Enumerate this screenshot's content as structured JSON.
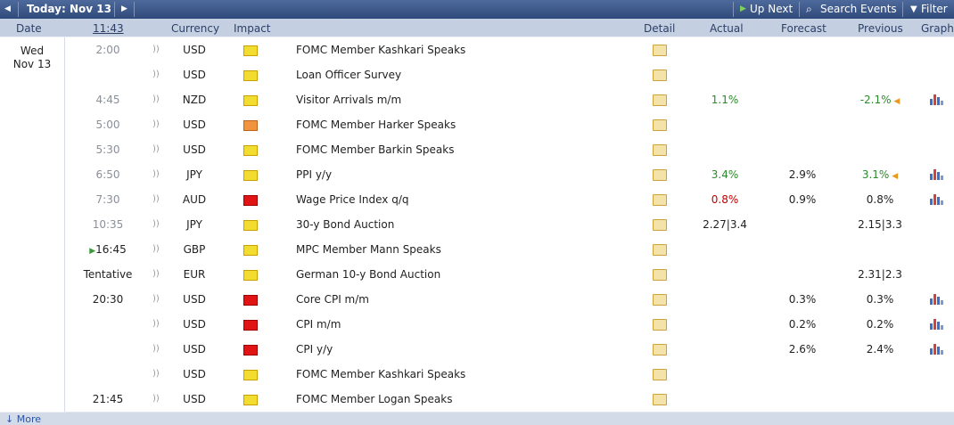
{
  "nav": {
    "prev_icon": "◀",
    "title": "Today: Nov 13",
    "next_icon": "▶",
    "up_next": "Up Next",
    "search": "Search Events",
    "filter": "Filter"
  },
  "columns": {
    "date": "Date",
    "time": "11:43",
    "currency": "Currency",
    "impact": "Impact",
    "detail": "Detail",
    "actual": "Actual",
    "forecast": "Forecast",
    "previous": "Previous",
    "graph": "Graph"
  },
  "day": {
    "weekday": "Wed",
    "date": "Nov 13"
  },
  "rows": [
    {
      "time": "2:00",
      "currency": "USD",
      "impact": "low",
      "event": "FOMC Member Kashkari Speaks",
      "actual": "",
      "forecast": "",
      "previous": "",
      "graph": false
    },
    {
      "time": "",
      "currency": "USD",
      "impact": "low",
      "event": "Loan Officer Survey",
      "actual": "",
      "forecast": "",
      "previous": "",
      "graph": false
    },
    {
      "time": "4:45",
      "currency": "NZD",
      "impact": "low",
      "event": "Visitor Arrivals m/m",
      "actual": "1.1%",
      "forecast": "",
      "previous": "-2.1%",
      "graph": true
    },
    {
      "time": "5:00",
      "currency": "USD",
      "impact": "med",
      "event": "FOMC Member Harker Speaks",
      "actual": "",
      "forecast": "",
      "previous": "",
      "graph": false
    },
    {
      "time": "5:30",
      "currency": "USD",
      "impact": "low",
      "event": "FOMC Member Barkin Speaks",
      "actual": "",
      "forecast": "",
      "previous": "",
      "graph": false
    },
    {
      "time": "6:50",
      "currency": "JPY",
      "impact": "low",
      "event": "PPI y/y",
      "actual": "3.4%",
      "forecast": "2.9%",
      "previous": "3.1%",
      "graph": true
    },
    {
      "time": "7:30",
      "currency": "AUD",
      "impact": "high",
      "event": "Wage Price Index q/q",
      "actual": "0.8%",
      "forecast": "0.9%",
      "previous": "0.8%",
      "graph": true
    },
    {
      "time": "10:35",
      "currency": "JPY",
      "impact": "low",
      "event": "30-y Bond Auction",
      "actual": "2.27|3.4",
      "forecast": "",
      "previous": "2.15|3.3",
      "graph": false
    },
    {
      "time": "16:45",
      "currency": "GBP",
      "impact": "low",
      "event": "MPC Member Mann Speaks",
      "actual": "",
      "forecast": "",
      "previous": "",
      "graph": false
    },
    {
      "time": "Tentative",
      "currency": "EUR",
      "impact": "low",
      "event": "German 10-y Bond Auction",
      "actual": "",
      "forecast": "",
      "previous": "2.31|2.3",
      "graph": false
    },
    {
      "time": "20:30",
      "currency": "USD",
      "impact": "high",
      "event": "Core CPI m/m",
      "actual": "",
      "forecast": "0.3%",
      "previous": "0.3%",
      "graph": true
    },
    {
      "time": "",
      "currency": "USD",
      "impact": "high",
      "event": "CPI m/m",
      "actual": "",
      "forecast": "0.2%",
      "previous": "0.2%",
      "graph": true
    },
    {
      "time": "",
      "currency": "USD",
      "impact": "high",
      "event": "CPI y/y",
      "actual": "",
      "forecast": "2.6%",
      "previous": "2.4%",
      "graph": true
    },
    {
      "time": "",
      "currency": "USD",
      "impact": "low",
      "event": "FOMC Member Kashkari Speaks",
      "actual": "",
      "forecast": "",
      "previous": "",
      "graph": false
    },
    {
      "time": "21:45",
      "currency": "USD",
      "impact": "low",
      "event": "FOMC Member Logan Speaks",
      "actual": "",
      "forecast": "",
      "previous": "",
      "graph": false
    }
  ],
  "footer": {
    "more": "More"
  }
}
